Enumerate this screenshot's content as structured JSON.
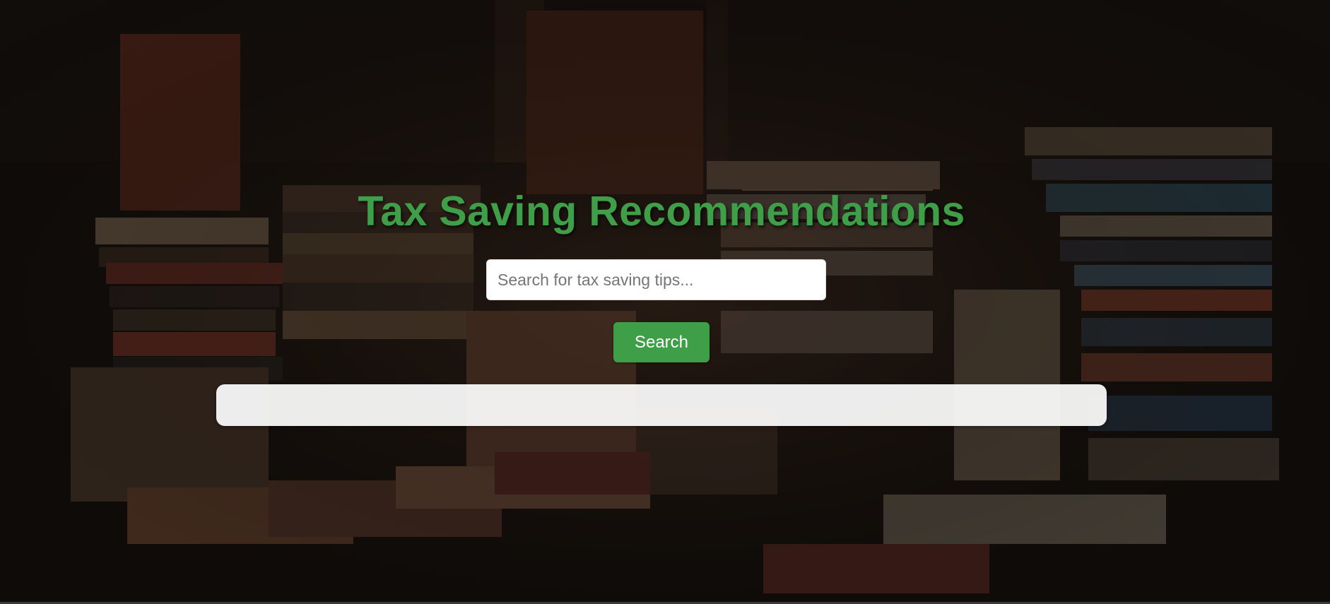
{
  "page": {
    "title": "Tax Saving Recommendations"
  },
  "search": {
    "placeholder": "Search for tax saving tips...",
    "value": "",
    "button_label": "Search"
  },
  "results": {
    "text": ""
  },
  "colors": {
    "accent": "#3f9e48",
    "input_background": "#ffffff",
    "results_background": "#f2f2f2"
  }
}
